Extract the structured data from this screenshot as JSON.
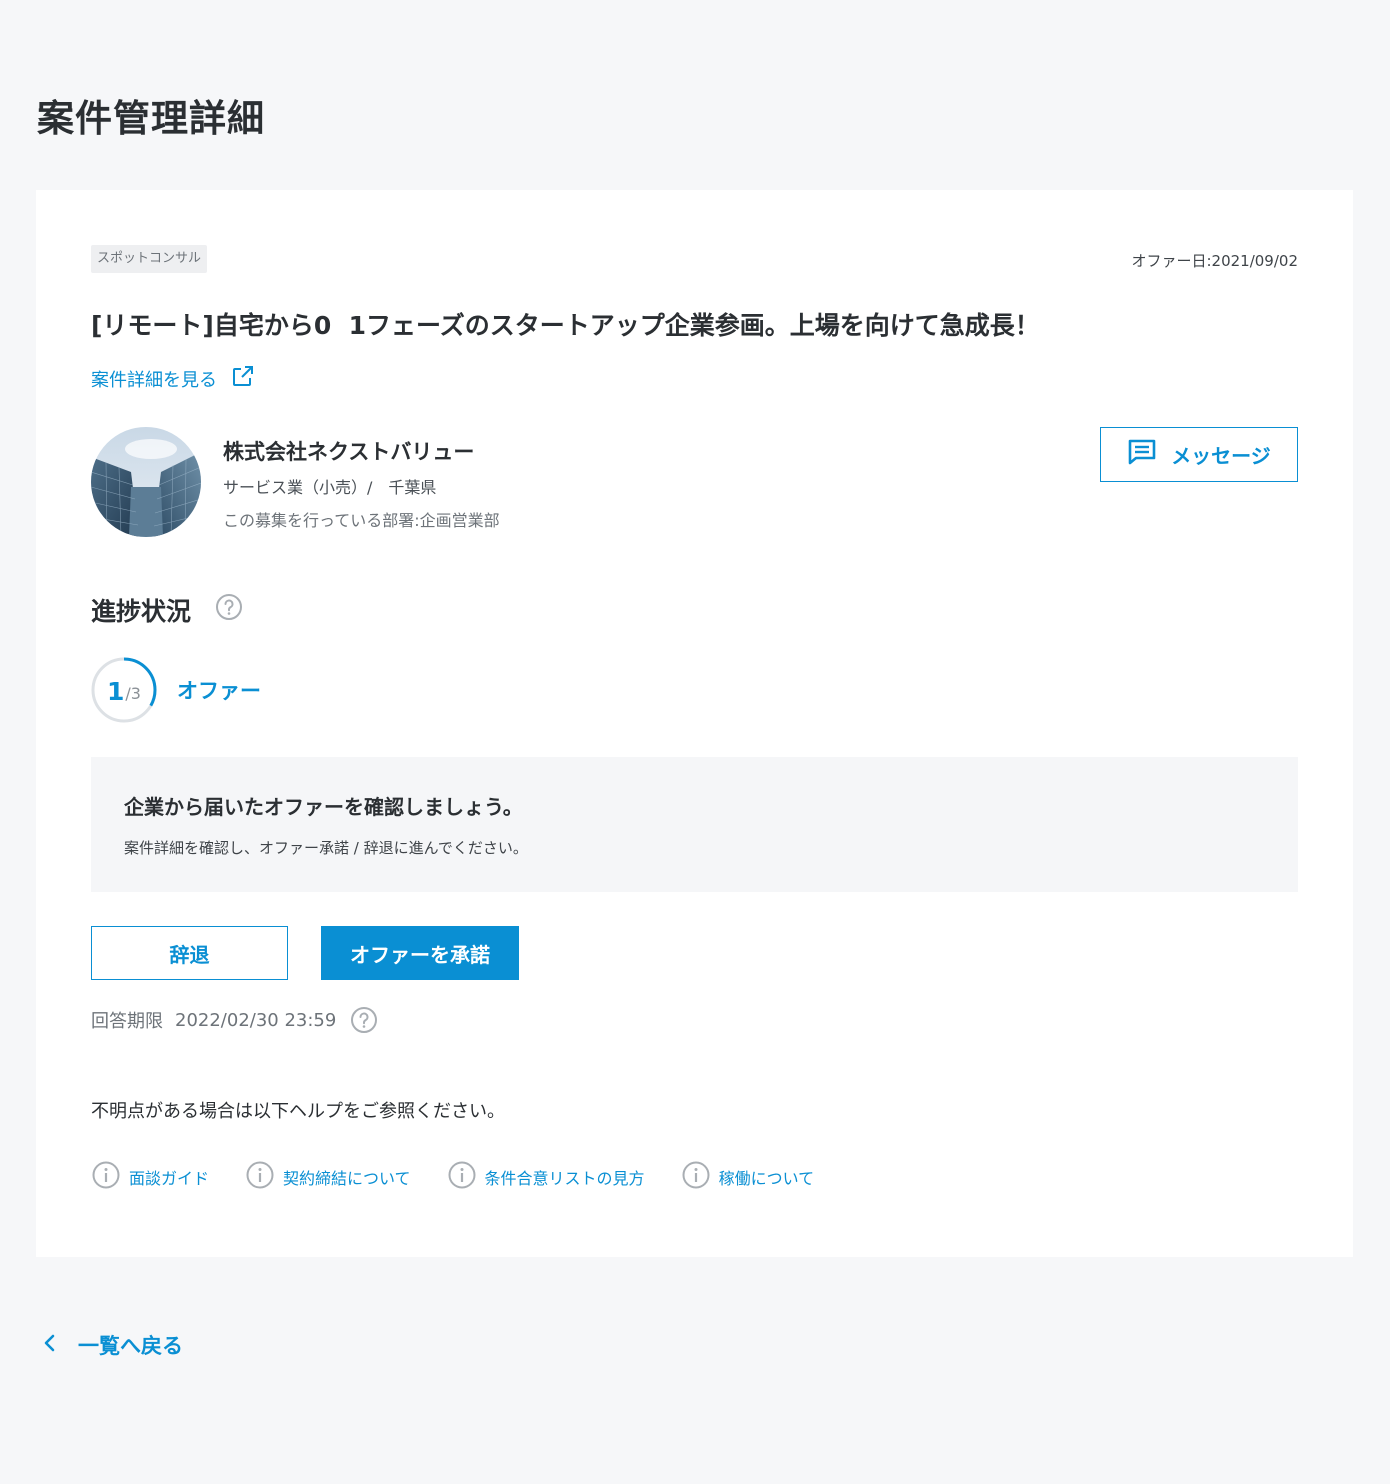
{
  "page_title": "案件管理詳細",
  "colors": {
    "accent": "#0a8fd3",
    "background": "#f6f7f9",
    "card": "#ffffff"
  },
  "card": {
    "tag": "スポットコンサル",
    "offer_date": "オファー日:2021/09/02",
    "job_title": "[リモート]自宅から0  1フェーズのスタートアップ企業参画。上場を向けて急成長！",
    "detail_link": {
      "label": "案件詳細を見る",
      "icon": "external-link-icon"
    },
    "company": {
      "name": "株式会社ネクストバリュー",
      "meta": "サービス業（小売）/　千葉県",
      "department": "この募集を行っている部署:企画営業部"
    },
    "message_button": {
      "label": "メッセージ",
      "icon": "chat-icon"
    }
  },
  "progress": {
    "section_title": "進捗状況",
    "current": "1",
    "total": "/3",
    "fraction": 0.3333,
    "stage_label": "オファー"
  },
  "info_box": {
    "title": "企業から届いたオファーを確認しましょう。",
    "text": "案件詳細を確認し、オファー承諾 / 辞退に進んでください。"
  },
  "actions": {
    "decline_label": "辞退",
    "accept_label": "オファーを承諾"
  },
  "deadline": {
    "label": "回答期限",
    "value": "2022/02/30 23:59"
  },
  "help": {
    "note": "不明点がある場合は以下ヘルプをご参照ください。",
    "links": [
      "面談ガイド",
      "契約締結について",
      "条件合意リストの見方",
      "稼働について"
    ]
  },
  "back_link": "一覧へ戻る"
}
